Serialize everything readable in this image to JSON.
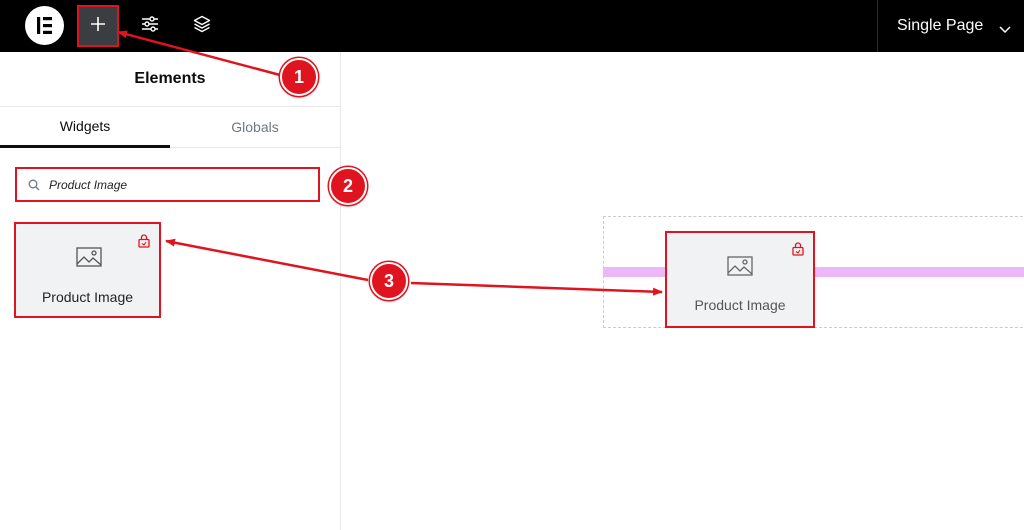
{
  "topbar": {
    "page_selector_label": "Single Page",
    "icons": [
      "elementor-logo-icon",
      "plus-icon",
      "sliders-icon",
      "layers-icon",
      "chevron-down-icon"
    ]
  },
  "panel": {
    "title": "Elements",
    "tabs": [
      {
        "label": "Widgets",
        "active": true
      },
      {
        "label": "Globals",
        "active": false
      }
    ],
    "search": {
      "value": "Product Image",
      "placeholder": ""
    },
    "widgets": [
      {
        "label": "Product Image",
        "icon": "image-icon",
        "pro": true
      }
    ]
  },
  "canvas": {
    "dropped_widget": {
      "label": "Product Image",
      "icon": "image-icon",
      "pro": true
    }
  },
  "annotations": [
    {
      "label": "1"
    },
    {
      "label": "2"
    },
    {
      "label": "3"
    }
  ],
  "colors": {
    "annotation_red": "#e0141e",
    "drop_indicator": "#ebb7f9",
    "topbar": "#000000"
  }
}
